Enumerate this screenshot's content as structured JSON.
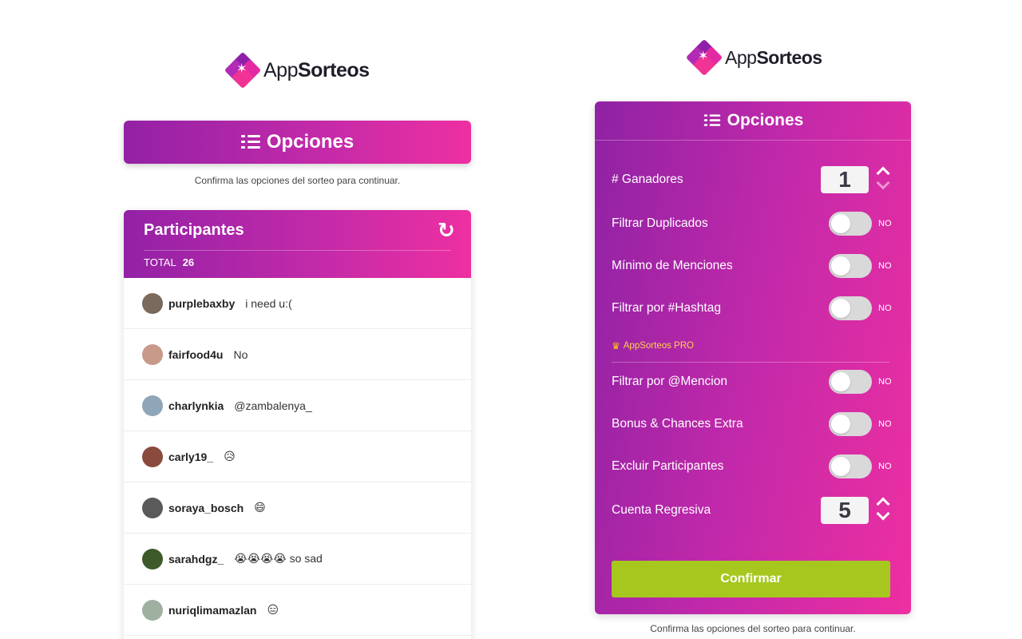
{
  "brand": {
    "name_light": "App",
    "name_bold": "Sorteos",
    "colors": {
      "gradient_start": "#9321a6",
      "gradient_end": "#ee2fa2",
      "confirm": "#a6c81e",
      "pro": "#ffd24a"
    }
  },
  "left": {
    "opciones_title": "Opciones",
    "hint": "Confirma las opciones del sorteo para continuar."
  },
  "participants": {
    "title": "Participantes",
    "total_label": "TOTAL",
    "total_value": "26",
    "refresh_icon": "↻",
    "rows": [
      {
        "username": "purplebaxby",
        "comment": "i need u:(",
        "avatar_color": "#7a6a5e"
      },
      {
        "username": "fairfood4u",
        "comment": "No",
        "avatar_color": "#c79a8a"
      },
      {
        "username": "charlynkia",
        "comment": "@zambalenya_",
        "avatar_color": "#8fa6b8"
      },
      {
        "username": "carly19_",
        "comment": "😥",
        "avatar_color": "#8a4a3e"
      },
      {
        "username": "soraya_bosch",
        "comment": "😄",
        "avatar_color": "#5a5a5a"
      },
      {
        "username": "sarahdgz_",
        "comment": "😭😭😭😭 so sad",
        "avatar_color": "#3c5a2a"
      },
      {
        "username": "nuriqlimamazlan",
        "comment": "😑",
        "avatar_color": "#9fb0a0"
      }
    ]
  },
  "options": {
    "title": "Opciones",
    "ganadores": {
      "label": "# Ganadores",
      "value": "1"
    },
    "toggles_basic": [
      {
        "label": "Filtrar Duplicados",
        "state": "NO"
      },
      {
        "label": "Mínimo de Menciones",
        "state": "NO"
      },
      {
        "label": "Filtrar por #Hashtag",
        "state": "NO"
      }
    ],
    "pro_label": "AppSorteos PRO",
    "crown_icon": "♛",
    "toggles_pro": [
      {
        "label": "Filtrar por @Mencion",
        "state": "NO"
      },
      {
        "label": "Bonus & Chances Extra",
        "state": "NO"
      },
      {
        "label": "Excluir Participantes",
        "state": "NO"
      }
    ],
    "countdown": {
      "label": "Cuenta Regresiva",
      "value": "5"
    },
    "confirm_label": "Confirmar",
    "hint": "Confirma las opciones del sorteo para continuar."
  }
}
